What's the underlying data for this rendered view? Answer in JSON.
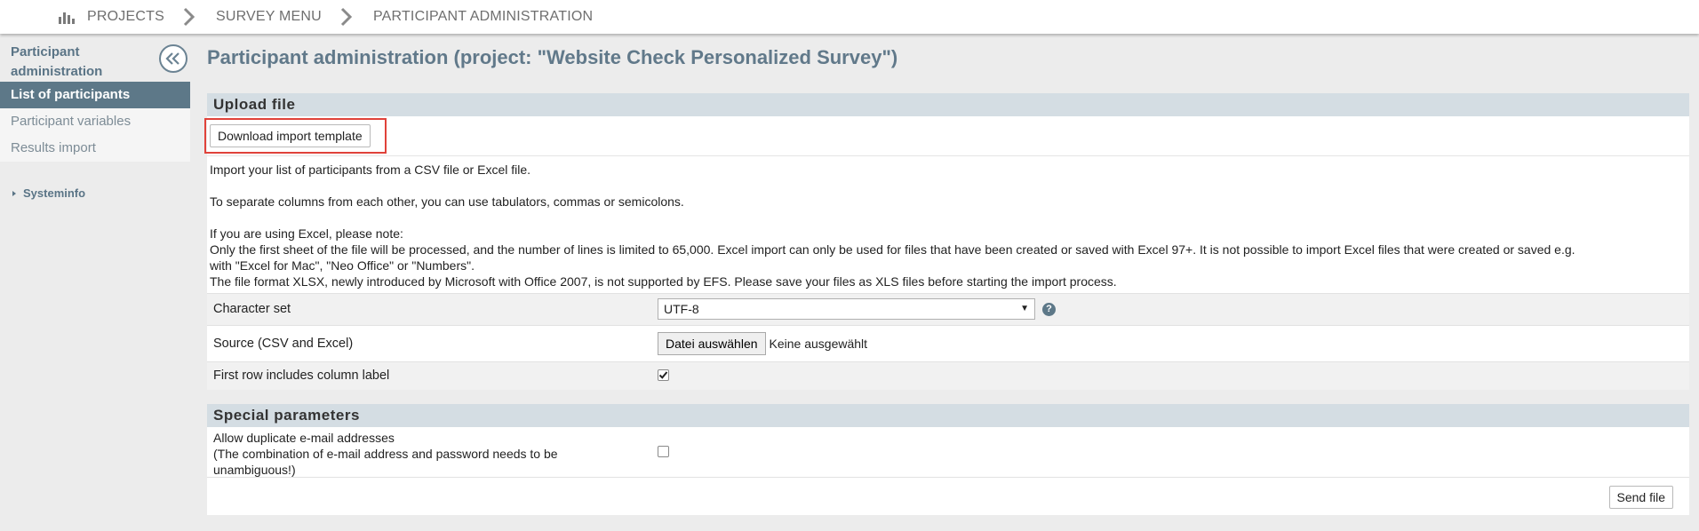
{
  "breadcrumb": {
    "items": [
      "PROJECTS",
      "SURVEY MENU",
      "PARTICIPANT ADMINISTRATION"
    ]
  },
  "sidebar": {
    "title": "Participant administration",
    "items": [
      {
        "label": "List of participants",
        "active": true
      },
      {
        "label": "Participant variables",
        "active": false
      },
      {
        "label": "Results import",
        "active": false
      }
    ],
    "systeminfo": "Systeminfo"
  },
  "main": {
    "title": "Participant administration (project: \"Website Check Personalized Survey\")",
    "upload": {
      "heading": "Upload file",
      "download_button": "Download import template",
      "info": {
        "line1": "Import your list of participants from a CSV file or Excel file.",
        "line2": "To separate columns from each other, you can use tabulators, commas or semicolons.",
        "line3": "If you are using Excel, please note:",
        "line4": "Only the first sheet of the file will be processed, and the number of lines is limited to 65,000. Excel import can only be used for files that have been created or saved with Excel 97+. It is not possible to import Excel files that were created or saved e.g.",
        "line5": "with \"Excel for Mac\", \"Neo Office\" or \"Numbers\".",
        "line6": "The file format XLSX, newly introduced by Microsoft with Office 2007, is not supported by EFS. Please save your files as XLS files before starting the import process."
      },
      "charset_label": "Character set",
      "charset_value": "UTF-8",
      "source_label": "Source (CSV and Excel)",
      "choose_file_button": "Datei auswählen",
      "no_file_text": "Keine ausgewählt",
      "first_row_label": "First row includes column label",
      "first_row_checked": true
    },
    "special": {
      "heading": "Special parameters",
      "duplicate_label_1": "Allow duplicate e-mail addresses",
      "duplicate_label_2": "(The combination of e-mail address and password needs to be",
      "duplicate_label_3": "unambiguous!)",
      "duplicate_checked": false,
      "send_button": "Send file"
    }
  },
  "colors": {
    "accent": "#5d7888",
    "highlight_border": "#e0423a",
    "section_header": "#d4dde3"
  }
}
